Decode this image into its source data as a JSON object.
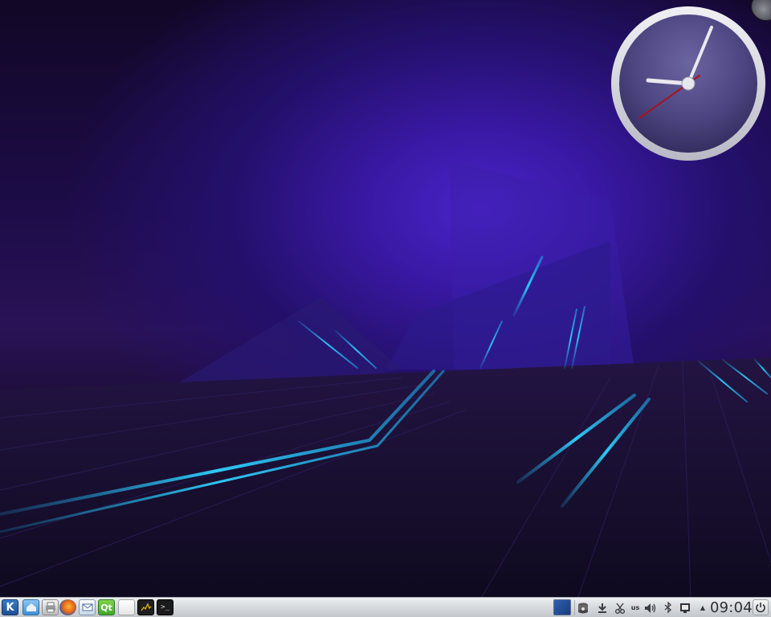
{
  "panel": {
    "launchers": {
      "kmenu": {
        "label": "K"
      },
      "qt": {
        "label": "Qt"
      },
      "terminal": {
        "label": ">_"
      }
    },
    "tray": {
      "keyboard_layout": "us",
      "expand_arrow": "▲"
    },
    "clock": {
      "time": "09:04"
    }
  },
  "colors": {
    "accent_cyan": "#26c6f2",
    "wallpaper_violet": "#4a23c9",
    "panel_gray": "#d4d7db"
  },
  "icons": [
    "k-menu-icon",
    "home-folder-icon",
    "printer-icon",
    "firefox-icon",
    "mail-icon",
    "qt-creator-icon",
    "blank-document-icon",
    "system-monitor-icon",
    "terminal-icon",
    "virtual-desktop-pager",
    "disk-icon",
    "download-icon",
    "scissors-icon",
    "keyboard-layout-indicator",
    "volume-icon",
    "bluetooth-icon",
    "network-icon",
    "show-hidden-tray-icon",
    "power-icon"
  ]
}
